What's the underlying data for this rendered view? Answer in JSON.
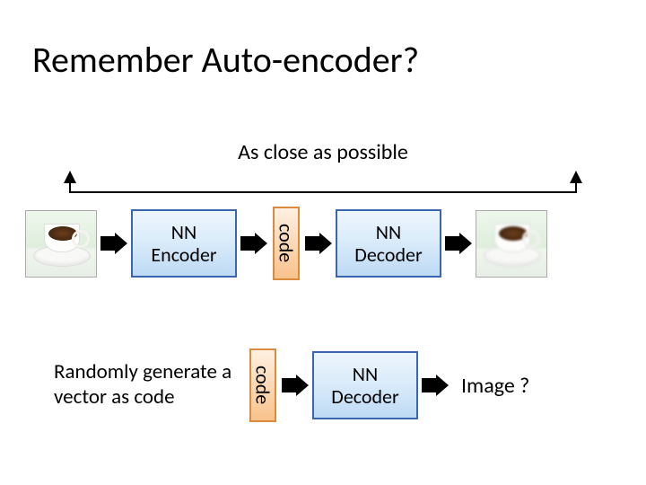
{
  "title": "Remember Auto-encoder?",
  "subtitle": "As close as possible",
  "row1": {
    "encoder_label": "NN\nEncoder",
    "code_label": "code",
    "decoder_label": "NN\nDecoder"
  },
  "row2": {
    "random_label": "Randomly generate a vector as code",
    "code_label": "code",
    "decoder_label": "NN\nDecoder",
    "output_label": "Image ?"
  }
}
